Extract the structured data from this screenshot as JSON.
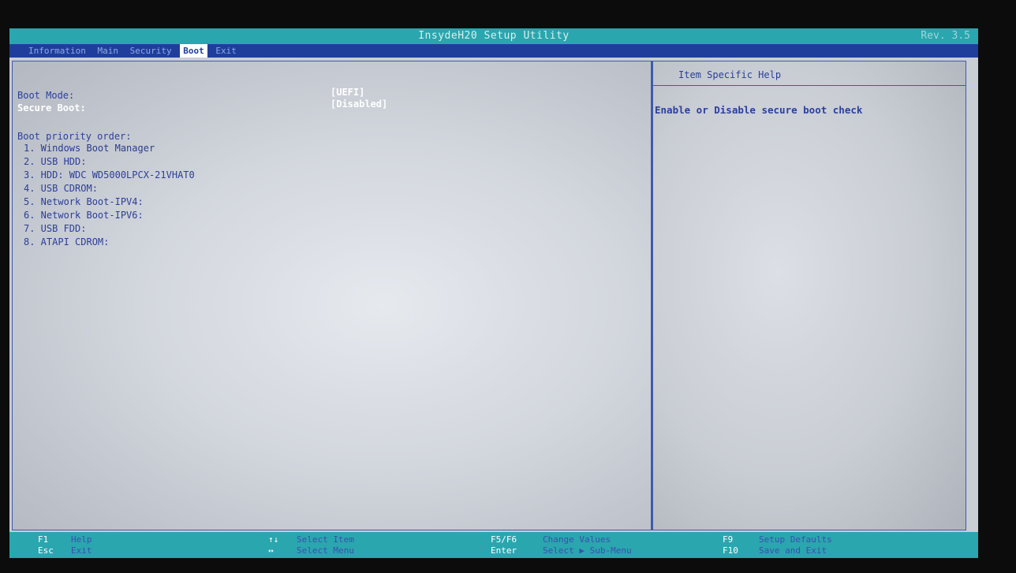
{
  "title_bar": {
    "title": "InsydeH20 Setup Utility",
    "revision": "Rev. 3.5"
  },
  "menu": {
    "tabs": [
      "Information",
      "Main",
      "Security",
      "Boot",
      "Exit"
    ],
    "active": "Boot"
  },
  "settings": {
    "boot_mode": {
      "label": "Boot Mode:",
      "value": "[UEFI]"
    },
    "secure_boot": {
      "label": "Secure Boot:",
      "value": "[Disabled]"
    }
  },
  "boot_priority": {
    "heading": "Boot priority order:",
    "items": [
      "1. Windows Boot Manager",
      "2. USB HDD:",
      "3. HDD: WDC WD5000LPCX-21VHAT0",
      "4. USB CDROM:",
      "5. Network Boot-IPV4:",
      "6. Network Boot-IPV6:",
      "7. USB FDD:",
      "8. ATAPI CDROM:"
    ]
  },
  "help": {
    "title": "Item Specific Help",
    "text": "Enable or Disable secure boot check"
  },
  "footer": {
    "keys": [
      {
        "key": "F1",
        "desc": "Help"
      },
      {
        "key": "Esc",
        "desc": "Exit"
      },
      {
        "key": "↑↓",
        "desc": "Select Item"
      },
      {
        "key": "↔",
        "desc": "Select Menu"
      },
      {
        "key": "F5/F6",
        "desc": "Change Values"
      },
      {
        "key": "Enter",
        "desc": "Select ▶ Sub-Menu"
      },
      {
        "key": "F9",
        "desc": "Setup Defaults"
      },
      {
        "key": "F10",
        "desc": "Save and Exit"
      }
    ]
  },
  "colors": {
    "title_bar": "#2aa6ae",
    "menu_bar": "#1f3e9c",
    "panel_text": "#2b3f9e",
    "highlight_text": "#ffffff"
  }
}
